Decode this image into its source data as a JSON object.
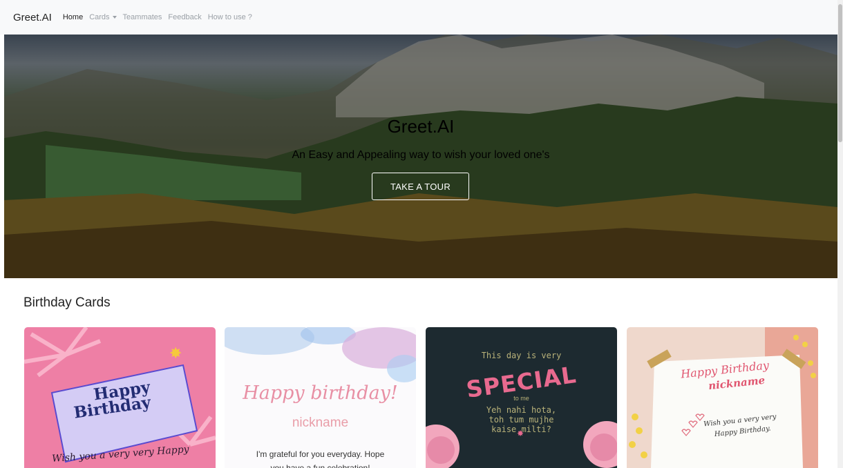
{
  "navbar": {
    "brand": "Greet.AI",
    "items": [
      {
        "label": "Home",
        "active": true
      },
      {
        "label": "Cards",
        "dropdown": true
      },
      {
        "label": "Teammates"
      },
      {
        "label": "Feedback"
      },
      {
        "label": "How to use ?"
      }
    ]
  },
  "hero": {
    "title": "Greet.AI",
    "subtitle": "An Easy and Appealing way to wish your loved one's",
    "button": "TAKE A TOUR"
  },
  "section": {
    "title": "Birthday Cards"
  },
  "cards": [
    {
      "line1": "Happy",
      "line2": "Birthday",
      "message": "Wish you a very very Happy"
    },
    {
      "heading": "Happy birthday!",
      "name": "nickname",
      "body1": "I'm grateful for you everyday. Hope",
      "body2": "you have a fun celebration!"
    },
    {
      "line1": "This day is very",
      "special": "SPECIAL",
      "line2": "to me",
      "line3": "Yeh nahi hota,",
      "line4": "toh tum mujhe",
      "line5": "kaise milti?"
    },
    {
      "heading": "Happy Birthday",
      "name": "nickname",
      "msg1": "Wish you a very very",
      "msg2": "Happy Birthday."
    }
  ],
  "colors": {
    "navbar_bg": "#f8f9fa",
    "card1_bg": "#ee7fa5",
    "card3_bg": "#1d2a30",
    "accent_pink": "#e86a8f"
  }
}
